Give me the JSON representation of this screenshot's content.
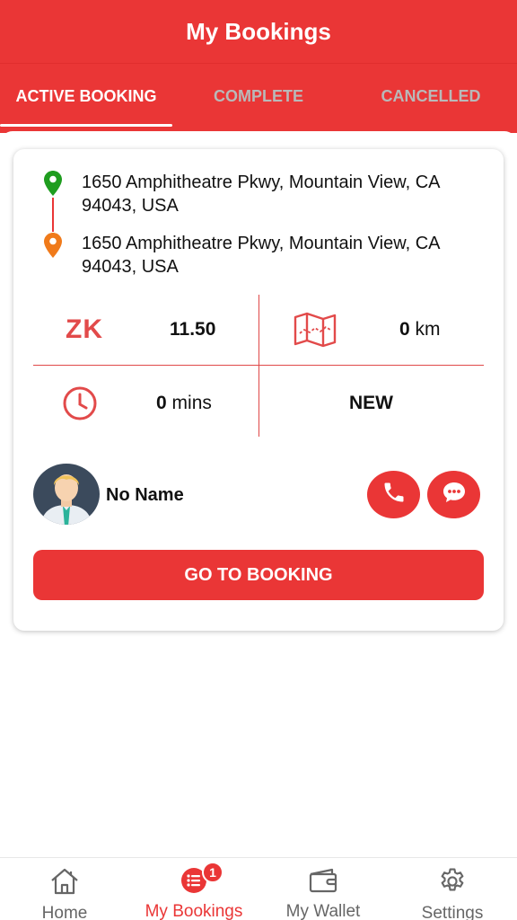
{
  "header": {
    "title": "My Bookings"
  },
  "tabs": [
    {
      "label": "ACTIVE BOOKING",
      "active": true
    },
    {
      "label": "COMPLETE",
      "active": false
    },
    {
      "label": "CANCELLED",
      "active": false
    }
  ],
  "booking": {
    "pickup_address": "1650 Amphitheatre Pkwy, Mountain View, CA 94043, USA",
    "dropoff_address": "1650 Amphitheatre Pkwy, Mountain View, CA 94043, USA",
    "currency": "ZK",
    "fare": "11.50",
    "distance_value": "0",
    "distance_unit": "km",
    "duration_value": "0",
    "duration_unit": "mins",
    "status": "NEW",
    "driver_name": "No Name",
    "go_button_label": "GO TO BOOKING"
  },
  "icons": {
    "pickup": "green-location-pin-icon",
    "dropoff": "orange-location-pin-icon",
    "distance": "map-icon",
    "duration": "clock-icon",
    "call": "phone-icon",
    "chat": "chat-bubble-icon"
  },
  "bottom_nav": {
    "items": [
      {
        "label": "Home",
        "icon": "home-icon",
        "active": false
      },
      {
        "label": "My Bookings",
        "icon": "list-icon",
        "active": true,
        "badge": "1"
      },
      {
        "label": "My Wallet",
        "icon": "wallet-icon",
        "active": false
      },
      {
        "label": "Settings",
        "icon": "gear-icon",
        "active": false
      }
    ]
  },
  "colors": {
    "primary": "#ea3636",
    "pickup_pin": "#1f9d1f",
    "dropoff_pin": "#f07a1a",
    "inactive_tab": "#b9b9b9"
  }
}
